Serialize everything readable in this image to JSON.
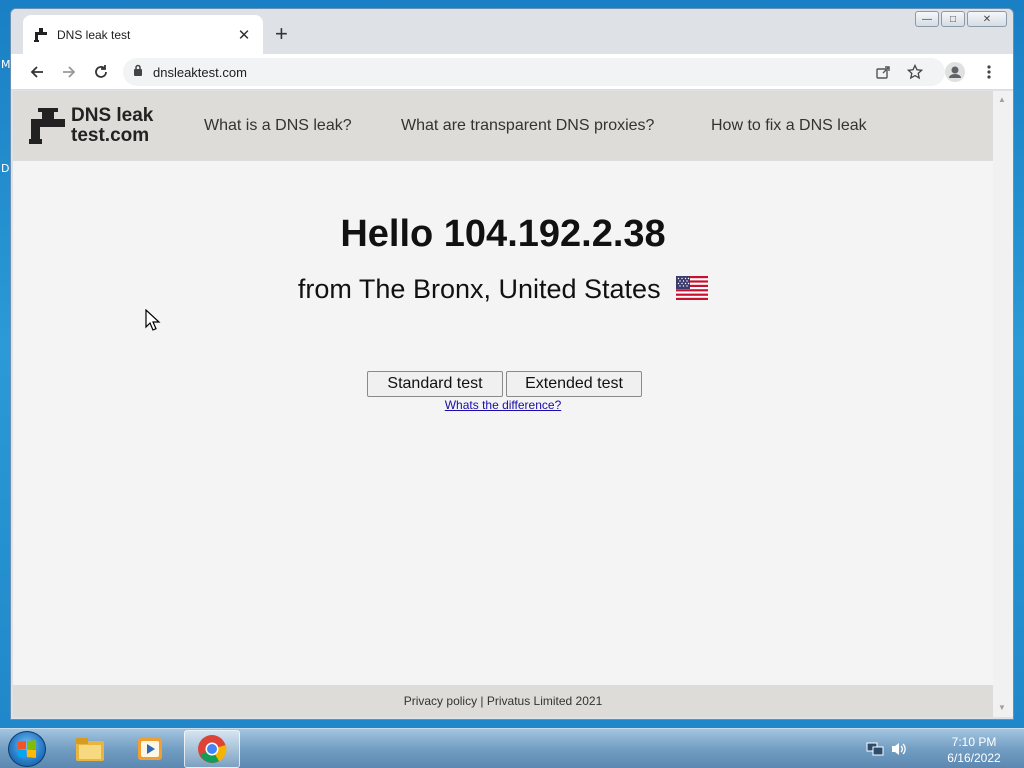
{
  "desktop": {
    "edge_text_1": "M",
    "edge_text_2": "D"
  },
  "browser": {
    "tab_title": "DNS leak test",
    "url": "dnsleaktest.com",
    "window_controls": {
      "minimize": "—",
      "maximize": "□",
      "close": "✕"
    }
  },
  "site": {
    "logo_line1": "DNS leak",
    "logo_line2": "test.com",
    "nav": [
      "What is a DNS leak?",
      "What are transparent DNS proxies?",
      "How to fix a DNS leak"
    ],
    "hello": "Hello 104.192.2.38",
    "location": "from The Bronx, United States",
    "flag_icon": "us-flag-icon",
    "buttons": {
      "standard": "Standard test",
      "extended": "Extended test"
    },
    "difference_link": "Whats the difference?",
    "footer": "Privacy policy | Privatus Limited 2021"
  },
  "taskbar": {
    "apps": [
      "file-explorer-icon",
      "media-player-icon",
      "chrome-icon"
    ],
    "active_app": "chrome-icon",
    "time": "7:10 PM",
    "date": "6/16/2022"
  },
  "colors": {
    "page_bg": "#f4f4f4",
    "header_bg": "#dedcd8",
    "link": "#1a0dab",
    "desktop_blue": "#1f86c8"
  }
}
